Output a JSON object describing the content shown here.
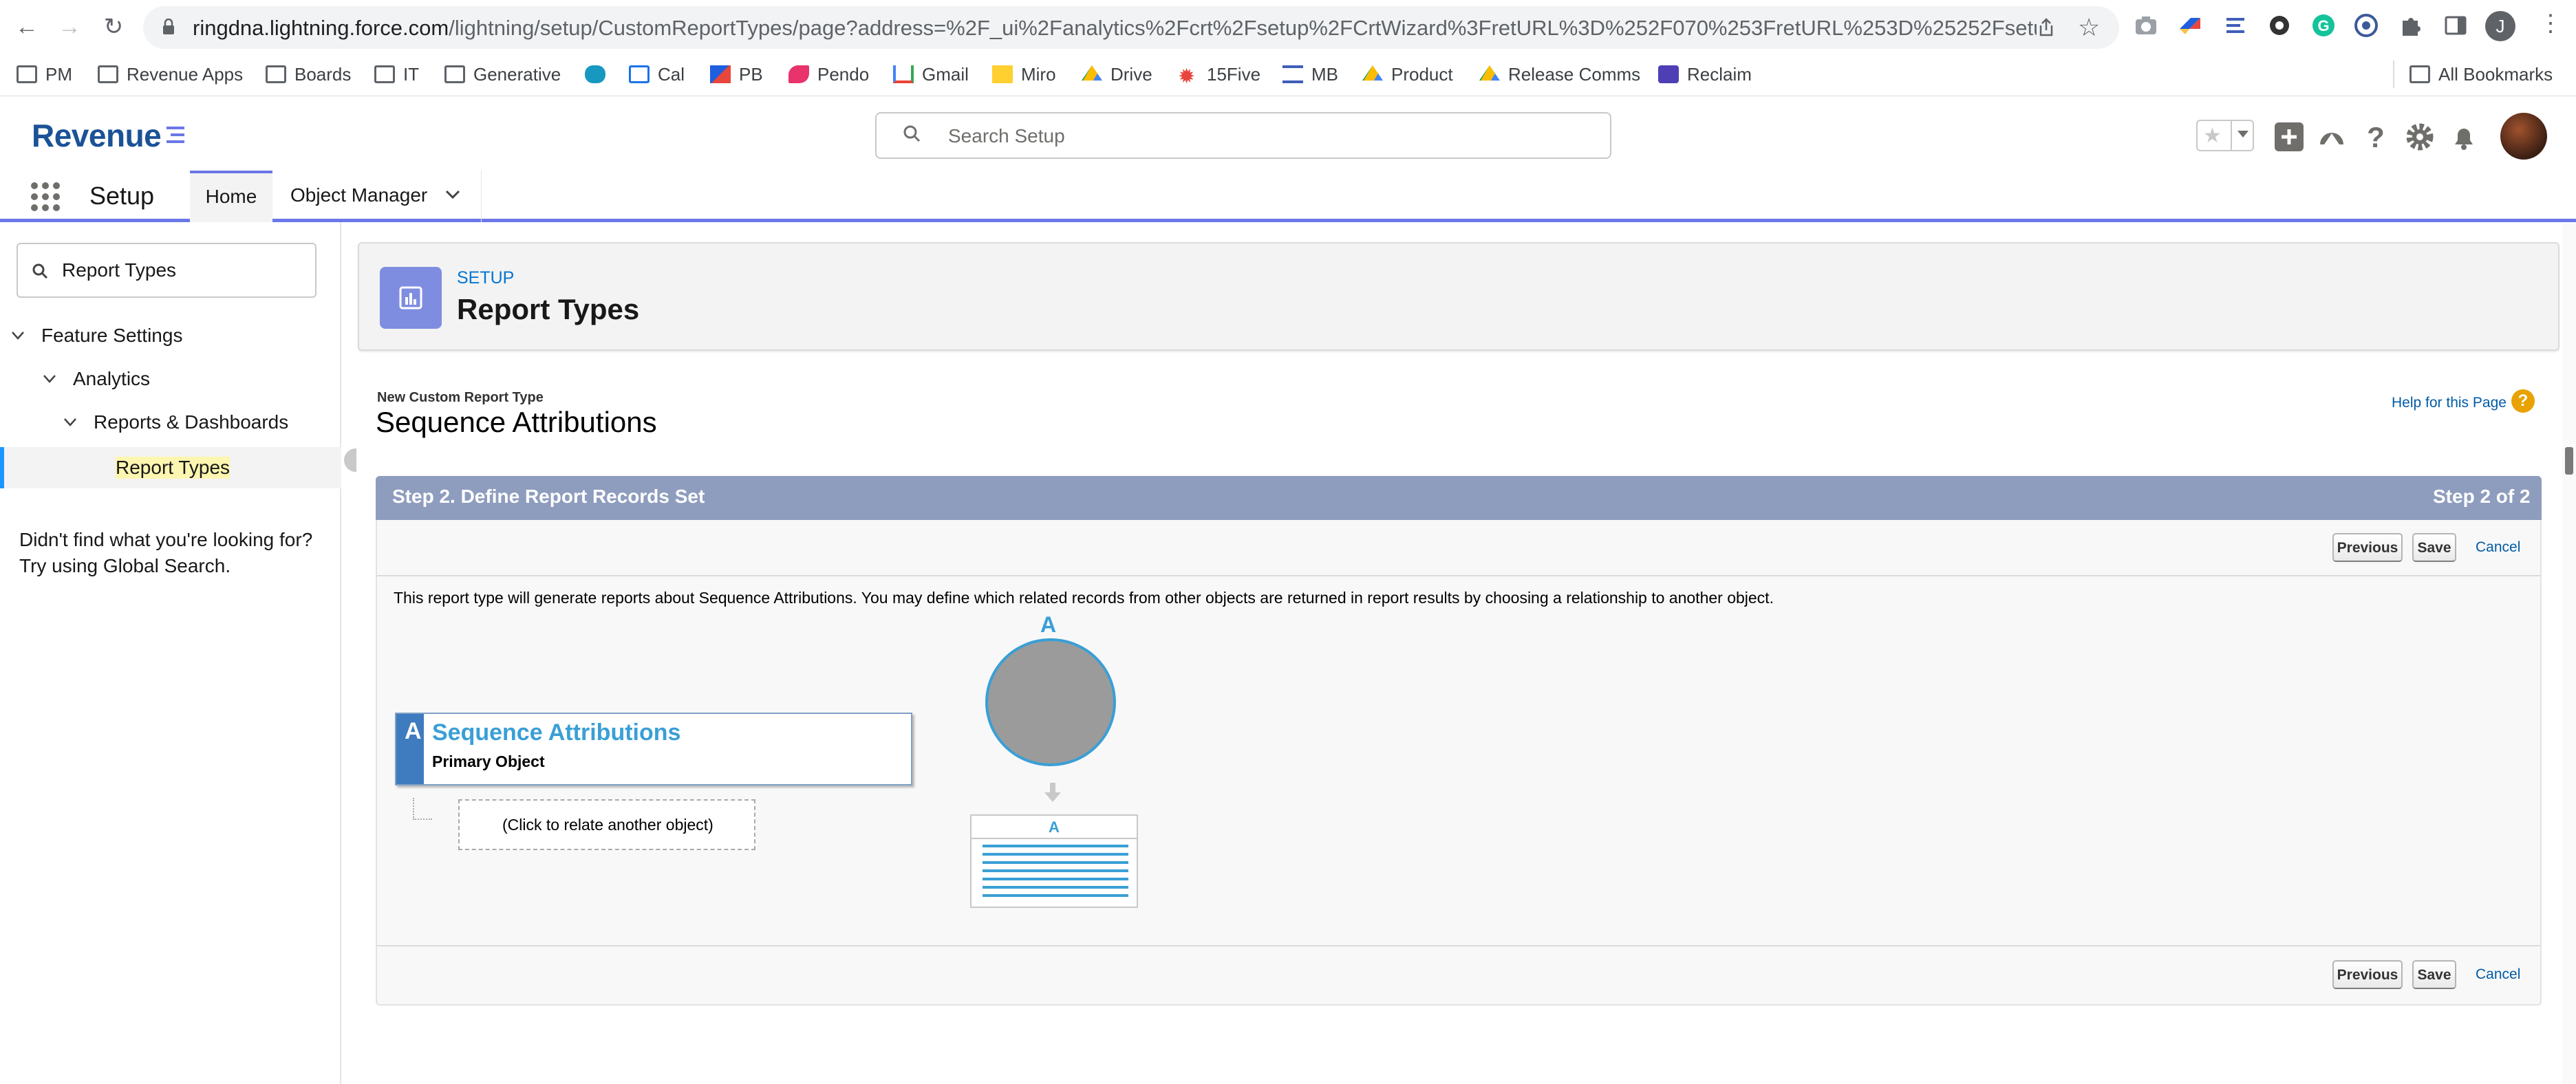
{
  "browser": {
    "url_host": "ringdna.lightning.force.com",
    "url_path": "/lightning/setup/CustomReportTypes/page?address=%2F_ui%2Fanalytics%2Fcrt%2Fsetup%2FCrtWizard%3FretURL%3D%252F070%253FretURL%253D%25252Fsetup%2...",
    "profile_initial": "J",
    "bookmarks": [
      "PM",
      "Revenue Apps",
      "Boards",
      "IT",
      "Generative",
      "Cal",
      "PB",
      "Pendo",
      "Gmail",
      "Miro",
      "Drive",
      "15Five",
      "MB",
      "Product",
      "Release Comms",
      "Reclaim"
    ],
    "all_bookmarks": "All Bookmarks"
  },
  "header": {
    "logo": "Revenue",
    "search_placeholder": "Search Setup"
  },
  "nav": {
    "app_name": "Setup",
    "tabs": [
      "Home",
      "Object Manager"
    ]
  },
  "sidebar": {
    "quick_find": "Report Types",
    "tree": {
      "feature_settings": "Feature Settings",
      "analytics": "Analytics",
      "reports_dashboards": "Reports & Dashboards",
      "report_types": "Report Types"
    },
    "not_found_line1": "Didn't find what you're looking for?",
    "not_found_line2": "Try using Global Search."
  },
  "page_header": {
    "eyebrow": "SETUP",
    "title": "Report Types"
  },
  "wizard": {
    "label": "New Custom Report Type",
    "title": "Sequence Attributions",
    "help_link": "Help for this Page",
    "step_title": "Step 2. Define Report Records Set",
    "step_count": "Step 2 of 2",
    "buttons": {
      "previous": "Previous",
      "save": "Save",
      "cancel": "Cancel"
    },
    "description": "This report type will generate reports about Sequence Attributions. You may define which related records from other objects are returned in report results by choosing a relationship to another object.",
    "primary_object": {
      "letter": "A",
      "name": "Sequence Attributions",
      "subtitle": "Primary Object"
    },
    "relate_prompt": "(Click to relate another object)",
    "diagram_label": "A",
    "result_label": "A"
  },
  "colors": {
    "brand": "#1b5297",
    "step_bar": "#8e9dbe",
    "accent_blue": "#3a9fd6",
    "setup_icon": "#7f8de1"
  }
}
